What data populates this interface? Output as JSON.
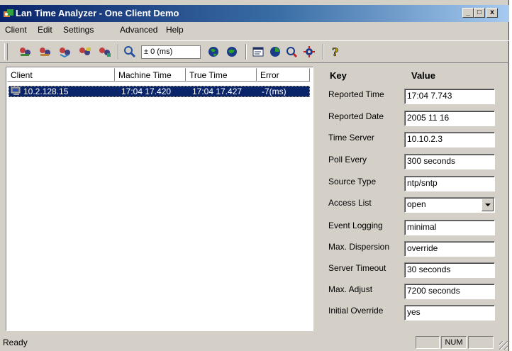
{
  "window": {
    "title": "Lan Time Analyzer - One Client Demo",
    "controls": [
      "_",
      "□",
      "x"
    ]
  },
  "menu": [
    "Client",
    "Edit",
    "Settings",
    "Advanced",
    "Help"
  ],
  "toolbar": {
    "offset_value": "± 0 (ms)"
  },
  "client_list": {
    "columns": [
      "Client",
      "Machine Time",
      "True Time",
      "Error"
    ],
    "rows": [
      {
        "client": "10.2.128.15",
        "machine_time": "17:04 17.420",
        "true_time": "17:04 17.427",
        "error": "-7(ms)"
      }
    ]
  },
  "details": {
    "header_key": "Key",
    "header_value": "Value",
    "items": [
      {
        "key": "Reported Time",
        "value": "17:04 7.743"
      },
      {
        "key": "Reported Date",
        "value": "2005 11 16"
      },
      {
        "key": "Time Server",
        "value": "10.10.2.3"
      },
      {
        "key": "Poll Every",
        "value": "300 seconds"
      },
      {
        "key": "Source Type",
        "value": "ntp/sntp"
      },
      {
        "key": "Access List",
        "value": "open"
      },
      {
        "key": "Event Logging",
        "value": "minimal"
      },
      {
        "key": "Max. Dispersion",
        "value": "override"
      },
      {
        "key": "Server Timeout",
        "value": "30 seconds"
      },
      {
        "key": "Max. Adjust",
        "value": "7200 seconds"
      },
      {
        "key": "Initial Override",
        "value": "yes"
      }
    ]
  },
  "status": {
    "text": "Ready",
    "num": "NUM"
  },
  "colors": {
    "title_start": "#0a246a",
    "selection": "#0a246a",
    "face": "#d4d0c8"
  }
}
